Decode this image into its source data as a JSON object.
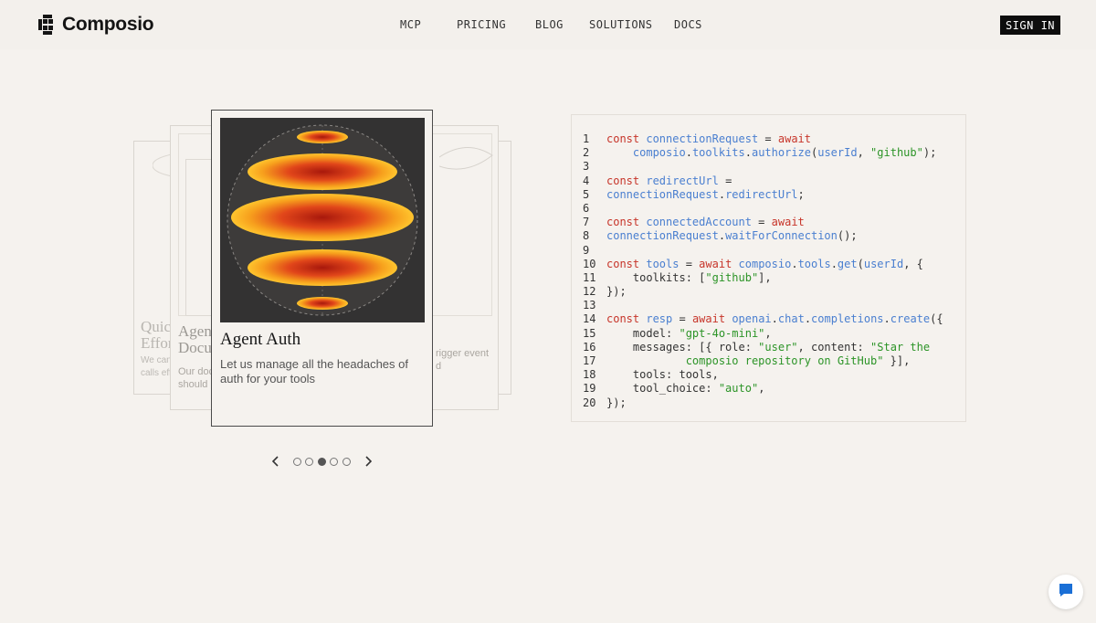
{
  "header": {
    "logo_text": "Composio",
    "nav": [
      "MCP",
      "PRICING",
      "BLOG",
      "SOLUTIONS",
      "DOCS"
    ],
    "signin_label": "SIGN IN"
  },
  "carousel": {
    "active_card": {
      "title": "Agent Auth",
      "description": "Let us manage all the headaches of auth for your tools"
    },
    "ghost_cards": {
      "far_left": {
        "title": "Quick\nEffort",
        "description": "We can\ncalls eff"
      },
      "left": {
        "title": "Agent\nDocu",
        "description": "Our doc\nshould"
      },
      "right": {
        "description": "rigger event\nd"
      }
    },
    "pager": {
      "total": 5,
      "active_index": 2
    }
  },
  "code": {
    "lines": [
      [
        [
          "k",
          "const "
        ],
        [
          "i",
          "connectionRequest"
        ],
        [
          "p",
          " = "
        ],
        [
          "k",
          "await"
        ]
      ],
      [
        [
          "p",
          "    "
        ],
        [
          "i",
          "composio"
        ],
        [
          "p",
          "."
        ],
        [
          "i",
          "toolkits"
        ],
        [
          "p",
          "."
        ],
        [
          "i",
          "authorize"
        ],
        [
          "p",
          "("
        ],
        [
          "i",
          "userId"
        ],
        [
          "p",
          ", "
        ],
        [
          "s",
          "\"github\""
        ],
        [
          "p",
          ");"
        ]
      ],
      [],
      [
        [
          "k",
          "const "
        ],
        [
          "i",
          "redirectUrl"
        ],
        [
          "p",
          " ="
        ]
      ],
      [
        [
          "i",
          "connectionRequest"
        ],
        [
          "p",
          "."
        ],
        [
          "i",
          "redirectUrl"
        ],
        [
          "p",
          ";"
        ]
      ],
      [],
      [
        [
          "k",
          "const "
        ],
        [
          "i",
          "connectedAccount"
        ],
        [
          "p",
          " = "
        ],
        [
          "k",
          "await"
        ]
      ],
      [
        [
          "i",
          "connectionRequest"
        ],
        [
          "p",
          "."
        ],
        [
          "i",
          "waitForConnection"
        ],
        [
          "p",
          "();"
        ]
      ],
      [],
      [
        [
          "k",
          "const "
        ],
        [
          "i",
          "tools"
        ],
        [
          "p",
          " = "
        ],
        [
          "k",
          "await "
        ],
        [
          "i",
          "composio"
        ],
        [
          "p",
          "."
        ],
        [
          "i",
          "tools"
        ],
        [
          "p",
          "."
        ],
        [
          "i",
          "get"
        ],
        [
          "p",
          "("
        ],
        [
          "i",
          "userId"
        ],
        [
          "p",
          ", {"
        ]
      ],
      [
        [
          "p",
          "    toolkits: ["
        ],
        [
          "s",
          "\"github\""
        ],
        [
          "p",
          "],"
        ]
      ],
      [
        [
          "p",
          "});"
        ]
      ],
      [],
      [
        [
          "k",
          "const "
        ],
        [
          "i",
          "resp"
        ],
        [
          "p",
          " = "
        ],
        [
          "k",
          "await "
        ],
        [
          "i",
          "openai"
        ],
        [
          "p",
          "."
        ],
        [
          "i",
          "chat"
        ],
        [
          "p",
          "."
        ],
        [
          "i",
          "completions"
        ],
        [
          "p",
          "."
        ],
        [
          "i",
          "create"
        ],
        [
          "p",
          "({"
        ]
      ],
      [
        [
          "p",
          "    model: "
        ],
        [
          "s",
          "\"gpt-4o-mini\""
        ],
        [
          "p",
          ","
        ]
      ],
      [
        [
          "p",
          "    messages: [{ role: "
        ],
        [
          "s",
          "\"user\""
        ],
        [
          "p",
          ", content: "
        ],
        [
          "s",
          "\"Star the"
        ]
      ],
      [
        [
          "s",
          "            composio repository on GitHub\""
        ],
        [
          "p",
          " }],"
        ]
      ],
      [
        [
          "p",
          "    tools: tools,"
        ]
      ],
      [
        [
          "p",
          "    tool_choice: "
        ],
        [
          "s",
          "\"auto\""
        ],
        [
          "p",
          ","
        ]
      ],
      [
        [
          "p",
          "});"
        ]
      ]
    ]
  },
  "colors": {
    "background": "#f5f2ee",
    "keyword": "#c7352a",
    "identifier": "#4a7fd0",
    "string": "#2c9427",
    "chat_icon": "#1a6fd6"
  },
  "icons": {
    "logo": "composio-logo-icon",
    "prev": "chevron-left-icon",
    "next": "chevron-right-icon",
    "chat": "chat-bubble-icon"
  }
}
